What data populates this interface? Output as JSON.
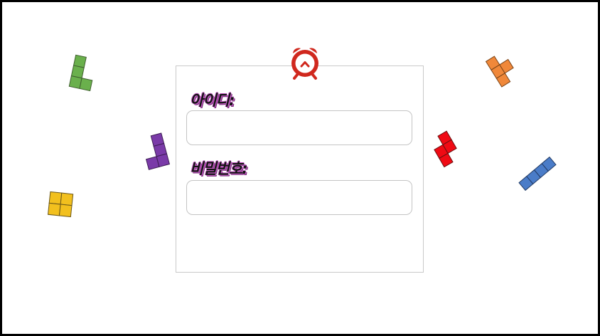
{
  "login_form": {
    "id_label": "아이디:",
    "id_value": "",
    "password_label": "비밀번호:",
    "password_value": ""
  },
  "icons": {
    "logo": "alarm-clock-icon"
  },
  "colors": {
    "clock_red": "#d0281e",
    "tetromino_green": "#6ab04c",
    "tetromino_purple": "#7a3aa8",
    "tetromino_yellow": "#f2c01e",
    "tetromino_orange": "#f0883a",
    "tetromino_red": "#f00a14",
    "tetromino_blue": "#4a7cc8",
    "label_glow": "#c85fc8"
  }
}
